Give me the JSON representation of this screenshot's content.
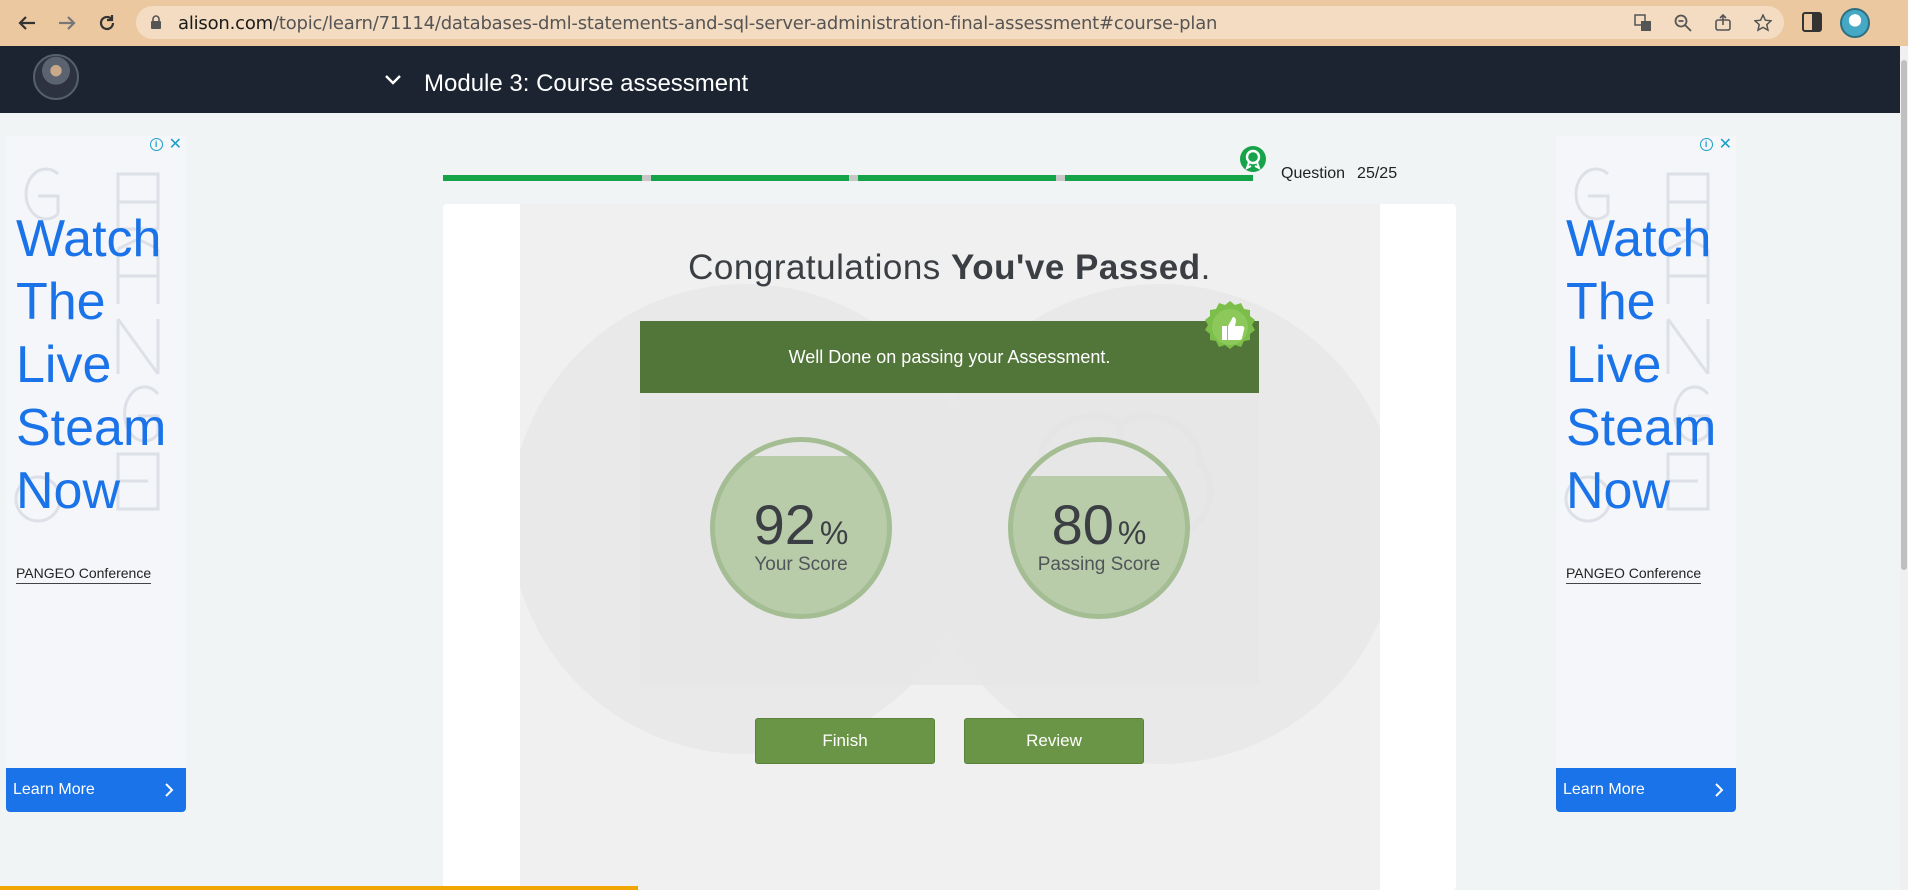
{
  "browser": {
    "url_host": "alison.com",
    "url_path": "/topic/learn/71114/databases-dml-statements-and-sql-server-administration-final-assessment#course-plan"
  },
  "header": {
    "module_title": "Module 3: Course assessment"
  },
  "ads": {
    "headline_lines": [
      "Watch",
      "The",
      "Live",
      "Steam",
      "Now"
    ],
    "sponsor_link": "PANGEO Conference",
    "cta_label": "Learn More"
  },
  "progress": {
    "question_label": "Question",
    "question_value": "25/25",
    "completed_fraction": 1.0
  },
  "result": {
    "title_prefix": "Congratulations",
    "title_bold": "You've Passed",
    "title_suffix": ".",
    "banner": "Well Done on passing your Assessment.",
    "your_score": {
      "value": "92",
      "unit": "%",
      "label": "Your Score",
      "fraction": 0.92
    },
    "passing_score": {
      "value": "80",
      "unit": "%",
      "label": "Passing Score",
      "fraction": 0.8
    }
  },
  "buttons": {
    "finish": "Finish",
    "review": "Review"
  },
  "colors": {
    "header_bg": "#1c2331",
    "progress_green": "#15a34a",
    "banner_green": "#52753a",
    "button_green": "#6b9546",
    "ad_blue": "#1a73e8"
  }
}
